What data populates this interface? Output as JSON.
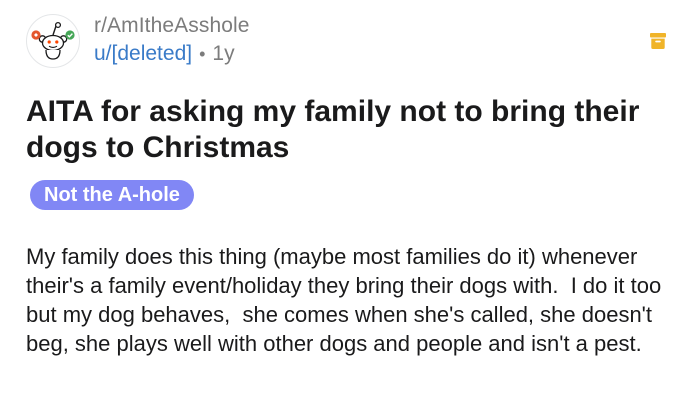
{
  "post": {
    "subreddit": "r/AmItheAsshole",
    "author": "u/[deleted]",
    "separator": "•",
    "age": "1y",
    "title": "AITA for asking my family not to bring their dogs to Christmas",
    "flair": "Not the A-hole",
    "body": "My family does this thing (maybe most families do it) whenever their's a family event/holiday they bring their dogs with.  I do it too but my dog behaves,  she comes when she's called, she doesn't beg, she plays well with other dogs and people and isn't a pest."
  },
  "icons": {
    "avatar": "reddit-snoo-icon",
    "archive": "archive-icon"
  },
  "colors": {
    "username": "#3a7bc8",
    "muted": "#7c7c7c",
    "flair_bg": "#8187f5",
    "flair_text": "#ffffff",
    "archive_icon": "#f0b429"
  }
}
